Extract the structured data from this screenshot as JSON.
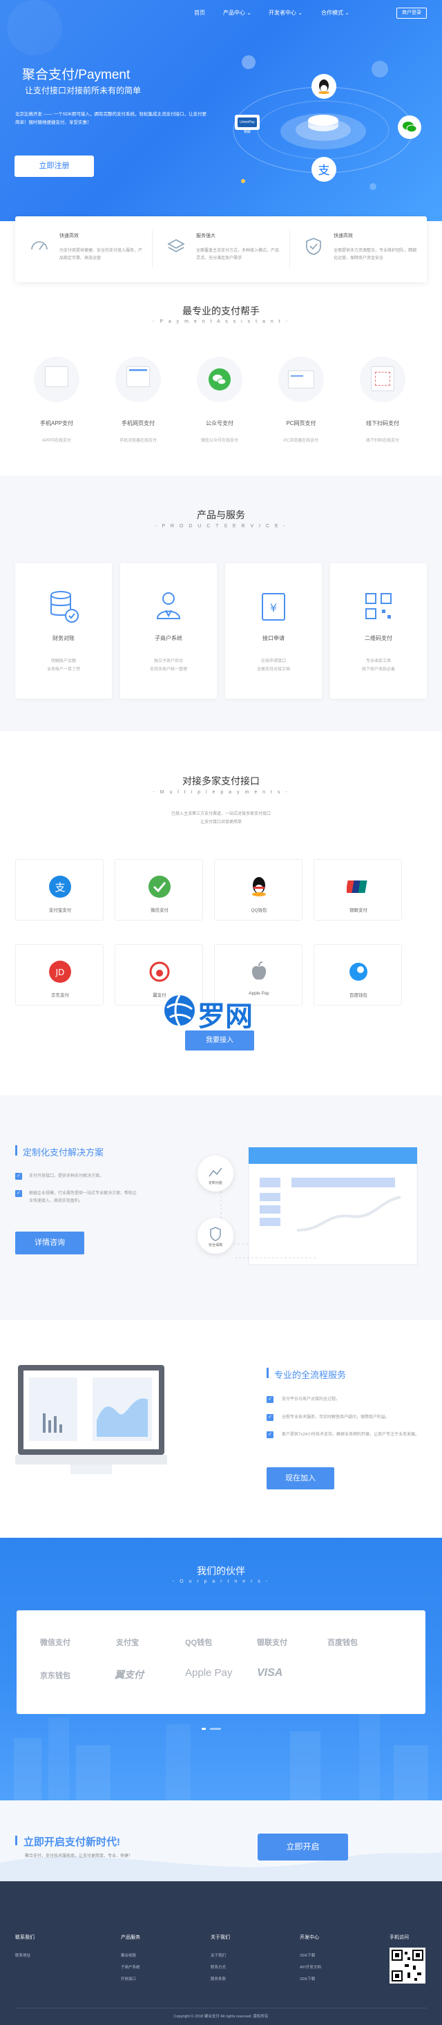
{
  "nav": {
    "items": [
      "首页",
      "产品中心 ⌄",
      "开发者中心 ⌄",
      "合作模式 ⌄"
    ],
    "login": "商户登录"
  },
  "hero": {
    "title": "聚合支付/Payment",
    "subtitle": "让支付接口对接前所未有的简单",
    "desc": "北京比格开发 —— 一个SDK即可接入，拥有完整的支付系统，轻松集成主流支付接口，让支付更简单！随时随地便捷支付、享受实惠！",
    "register": "立即注册",
    "card_label": "UnionPay 银联"
  },
  "features": [
    {
      "title": "快速高效",
      "desc": "为支付商提供便捷、安全的支付接入服务，产品稳定可靠、高效运营"
    },
    {
      "title": "服务强大",
      "desc": "全面覆盖主流支付方式，多种接入模式，产品灵活，充分满足商户需求"
    },
    {
      "title": "快速高效",
      "desc": "全面提供多方资源整合，专业维护团队，精细化运营，保障商户资金安全"
    }
  ],
  "assistant": {
    "title": "最专业的支付帮手",
    "subtitle": "- P a y m e n t   A s s i s t a n t -",
    "items": [
      {
        "label": "手机APP支付",
        "desc": "APP内在线支付"
      },
      {
        "label": "手机网页支付",
        "desc": "手机浏览器在线支付"
      },
      {
        "label": "公众号支付",
        "desc": "微信公众号在线支付"
      },
      {
        "label": "PC网页支付",
        "desc": "PC浏览器在线支付"
      },
      {
        "label": "线下扫码支付",
        "desc": "线下扫码在线支付"
      }
    ]
  },
  "product": {
    "title": "产品与服务",
    "subtitle": "- P R O D U C T   S E R V I C E -",
    "items": [
      {
        "label": "财务对账",
        "desc": "明细账户余额\n业务账户一目了然"
      },
      {
        "label": "子商户系统",
        "desc": "独立子商户后台\n支持多商户统一管理"
      },
      {
        "label": "接口申请",
        "desc": "在线申请接口\n全面支持对接文档"
      },
      {
        "label": "二维码支付",
        "desc": "专业收款工具\n线下商户收款必备"
      }
    ]
  },
  "payments": {
    "title": "对接多家支付接口",
    "subtitle": "- M u l t i p l e   p a y m e n t s -",
    "desc": "已接入主流第三方支付渠道，一站式对接多家支付接口\n让支付接口对接更简单",
    "items": [
      "支付宝支付",
      "微信支付",
      "QQ钱包",
      "银联支付",
      "京东支付",
      "翼支付",
      "Apple Pay",
      "百度钱包"
    ],
    "join": "我要接入"
  },
  "custom": {
    "title": "定制化支付解决方案",
    "items": [
      "支付开放接口，提供多种支付解决方案。",
      "根据企业规模，行业属性提供一站式专业解决方案，帮助企业快速接入，高效实现盈利。"
    ],
    "button": "详情咨询",
    "node1": "定制功能",
    "node2": "安全保障"
  },
  "service": {
    "title": "专业的全流程服务",
    "items": [
      "支付平台与商户对接的全过程。",
      "全程专业技术服务，可实时解答商户疑问，保障商户利益。",
      "客户提供7x24小时技术支持，确保业务顺利开展，让商户专注于业务发展。"
    ],
    "button": "现在加入"
  },
  "partners": {
    "title": "我们的伙伴",
    "subtitle": "- O u r   p a r t n e r s -",
    "items": [
      "微信支付",
      "支付宝",
      "QQ钱包",
      "银联支付",
      "百度钱包",
      "京东钱包",
      "翼支付",
      "Apple Pay",
      "VISA"
    ]
  },
  "cta": {
    "title": "立即开启支付新时代!",
    "desc": "聚合支付，支付技术服务商，让支付更简单、专业、快捷！",
    "button": "立即开启"
  },
  "footer": {
    "columns": [
      {
        "title": "联系我们",
        "links": [
          "联系地址"
        ]
      },
      {
        "title": "产品服务",
        "links": [
          "聚合收款",
          "子商户系统",
          "开放接口"
        ]
      },
      {
        "title": "关于我们",
        "links": [
          "关于我们",
          "联系方式",
          "服务条款"
        ]
      },
      {
        "title": "开发中心",
        "links": [
          "SDK下载",
          "API开发文档",
          "SDK下载"
        ]
      },
      {
        "title": "手机访问",
        "links": []
      }
    ],
    "copyright": "Copyright © 2018 聚合支付 All rights reserved. 版权所有"
  },
  "watermark": "罗网",
  "colors": {
    "primary": "#2d7cf2",
    "accent": "#4a90f0",
    "footer": "#2e3b55"
  }
}
